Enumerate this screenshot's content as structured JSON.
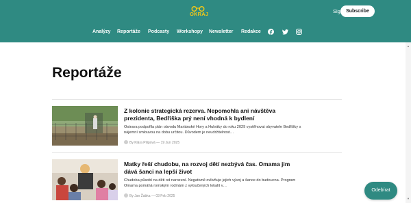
{
  "brand": {
    "logo_text": "OKRAJ",
    "logo_color": "#f6c915",
    "primary_color": "#2f8a82"
  },
  "header": {
    "signin_label": "Sign in",
    "subscribe_label": "Subscribe",
    "nav": [
      {
        "label": "Analýzy"
      },
      {
        "label": "Reportáže"
      },
      {
        "label": "Podcasty"
      },
      {
        "label": "Workshopy"
      },
      {
        "label": "Newsletter"
      },
      {
        "label": "Redakce"
      }
    ],
    "social_icons": [
      "facebook-icon",
      "twitter-icon",
      "instagram-icon"
    ]
  },
  "page": {
    "title": "Reportáže"
  },
  "articles": [
    {
      "title": "Z kolonie strategická rezerva. Nepomohla ani návštěva prezidenta, Bedřiška prý není vhodná k bydlení",
      "excerpt": "Ostrava podpořila plán obvodu Mariánské Hory a Hulváky do roku 2029 vystěhovat obyvatele Bedřišky s nájemní smlouvou na dobu určitou. Důvodem je neudržitelnost…",
      "meta": "By Klára Pilipová — 19 Jun 2025",
      "image_icon": "photo-fence-playground"
    },
    {
      "title": "Matky řeší chudobu, na rozvoj dětí nezbývá čas. Omama jim dává šanci na lepší život",
      "excerpt": "Chudoba působí na děti od narození. Negativně ovlivňuje jejich vývoj a šance do budoucna. Program Omama pomáhá romským rodinám z vyloučených lokalit v…",
      "meta": "By Jan Žabka — 03 Feb 2025",
      "image_icon": "photo-children-group"
    }
  ],
  "floating": {
    "label": "Odebírat"
  }
}
